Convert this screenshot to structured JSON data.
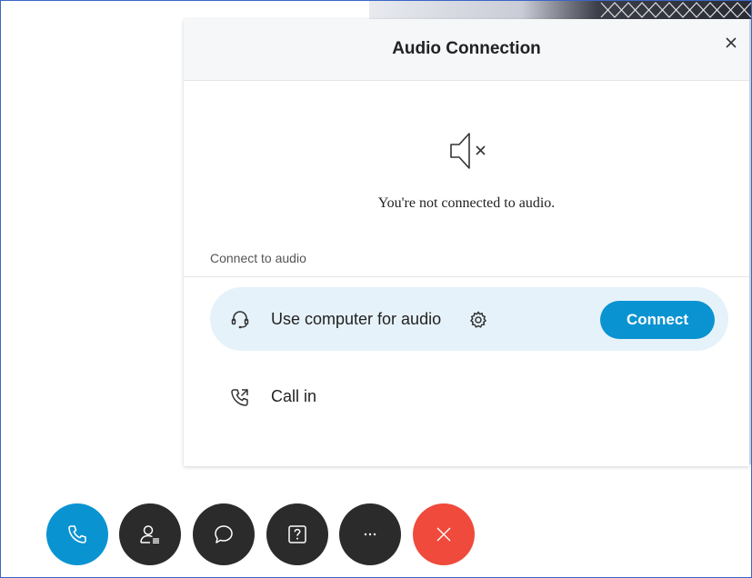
{
  "dialog": {
    "title": "Audio Connection",
    "status_text": "You're not connected to audio.",
    "section_label": "Connect to audio",
    "options": [
      {
        "label": "Use computer for audio",
        "icon": "headset-icon",
        "settings_icon": "gear-icon",
        "button_label": "Connect",
        "selected": true
      },
      {
        "label": "Call in",
        "icon": "phone-callout-icon",
        "selected": false
      }
    ],
    "close_icon": "close-icon",
    "status_icon": "speaker-muted-icon"
  },
  "toolbar": {
    "buttons": [
      {
        "icon": "phone-icon",
        "color": "#0a93d1"
      },
      {
        "icon": "participants-icon",
        "color": "#2b2b2b"
      },
      {
        "icon": "chat-icon",
        "color": "#2b2b2b"
      },
      {
        "icon": "question-icon",
        "color": "#2b2b2b"
      },
      {
        "icon": "more-icon",
        "color": "#2b2b2b"
      },
      {
        "icon": "close-icon",
        "color": "#ef4a3c"
      }
    ]
  },
  "colors": {
    "accent": "#0a93d1",
    "selected_row": "#e6f2fa",
    "leave": "#ef4a3c",
    "toolbar_dark": "#2b2b2b"
  }
}
